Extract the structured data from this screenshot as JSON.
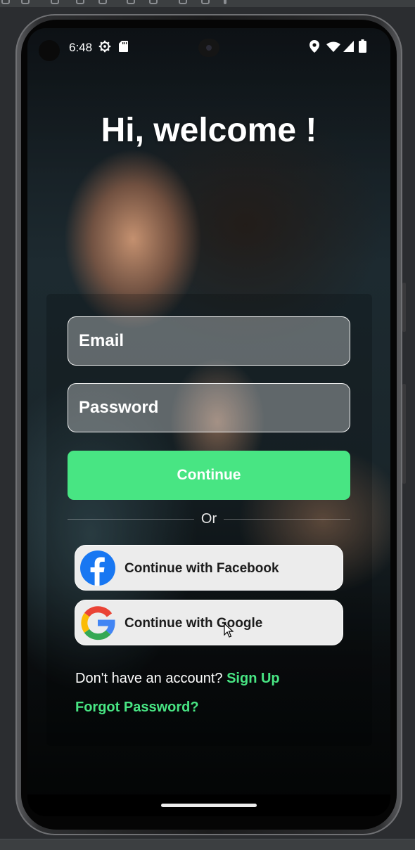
{
  "status_bar": {
    "time": "6:48",
    "icons": [
      "gear-icon",
      "sd-card-icon",
      "location-icon",
      "wifi-icon",
      "signal-icon",
      "battery-icon"
    ]
  },
  "welcome": {
    "title": "Hi, welcome !"
  },
  "form": {
    "email_placeholder": "Email",
    "password_placeholder": "Password",
    "continue_label": "Continue",
    "divider_text": "Or"
  },
  "social": {
    "facebook_label": "Continue with Facebook",
    "google_label": "Continue with Google"
  },
  "footer": {
    "signup_prompt": "Don't have an account? ",
    "signup_link": "Sign Up",
    "forgot_password": "Forgot Password?"
  },
  "colors": {
    "accent": "#48e583",
    "facebook_blue": "#1877f2",
    "google_blue": "#4285f4",
    "google_red": "#ea4335",
    "google_yellow": "#fbbc05",
    "google_green": "#34a853"
  }
}
